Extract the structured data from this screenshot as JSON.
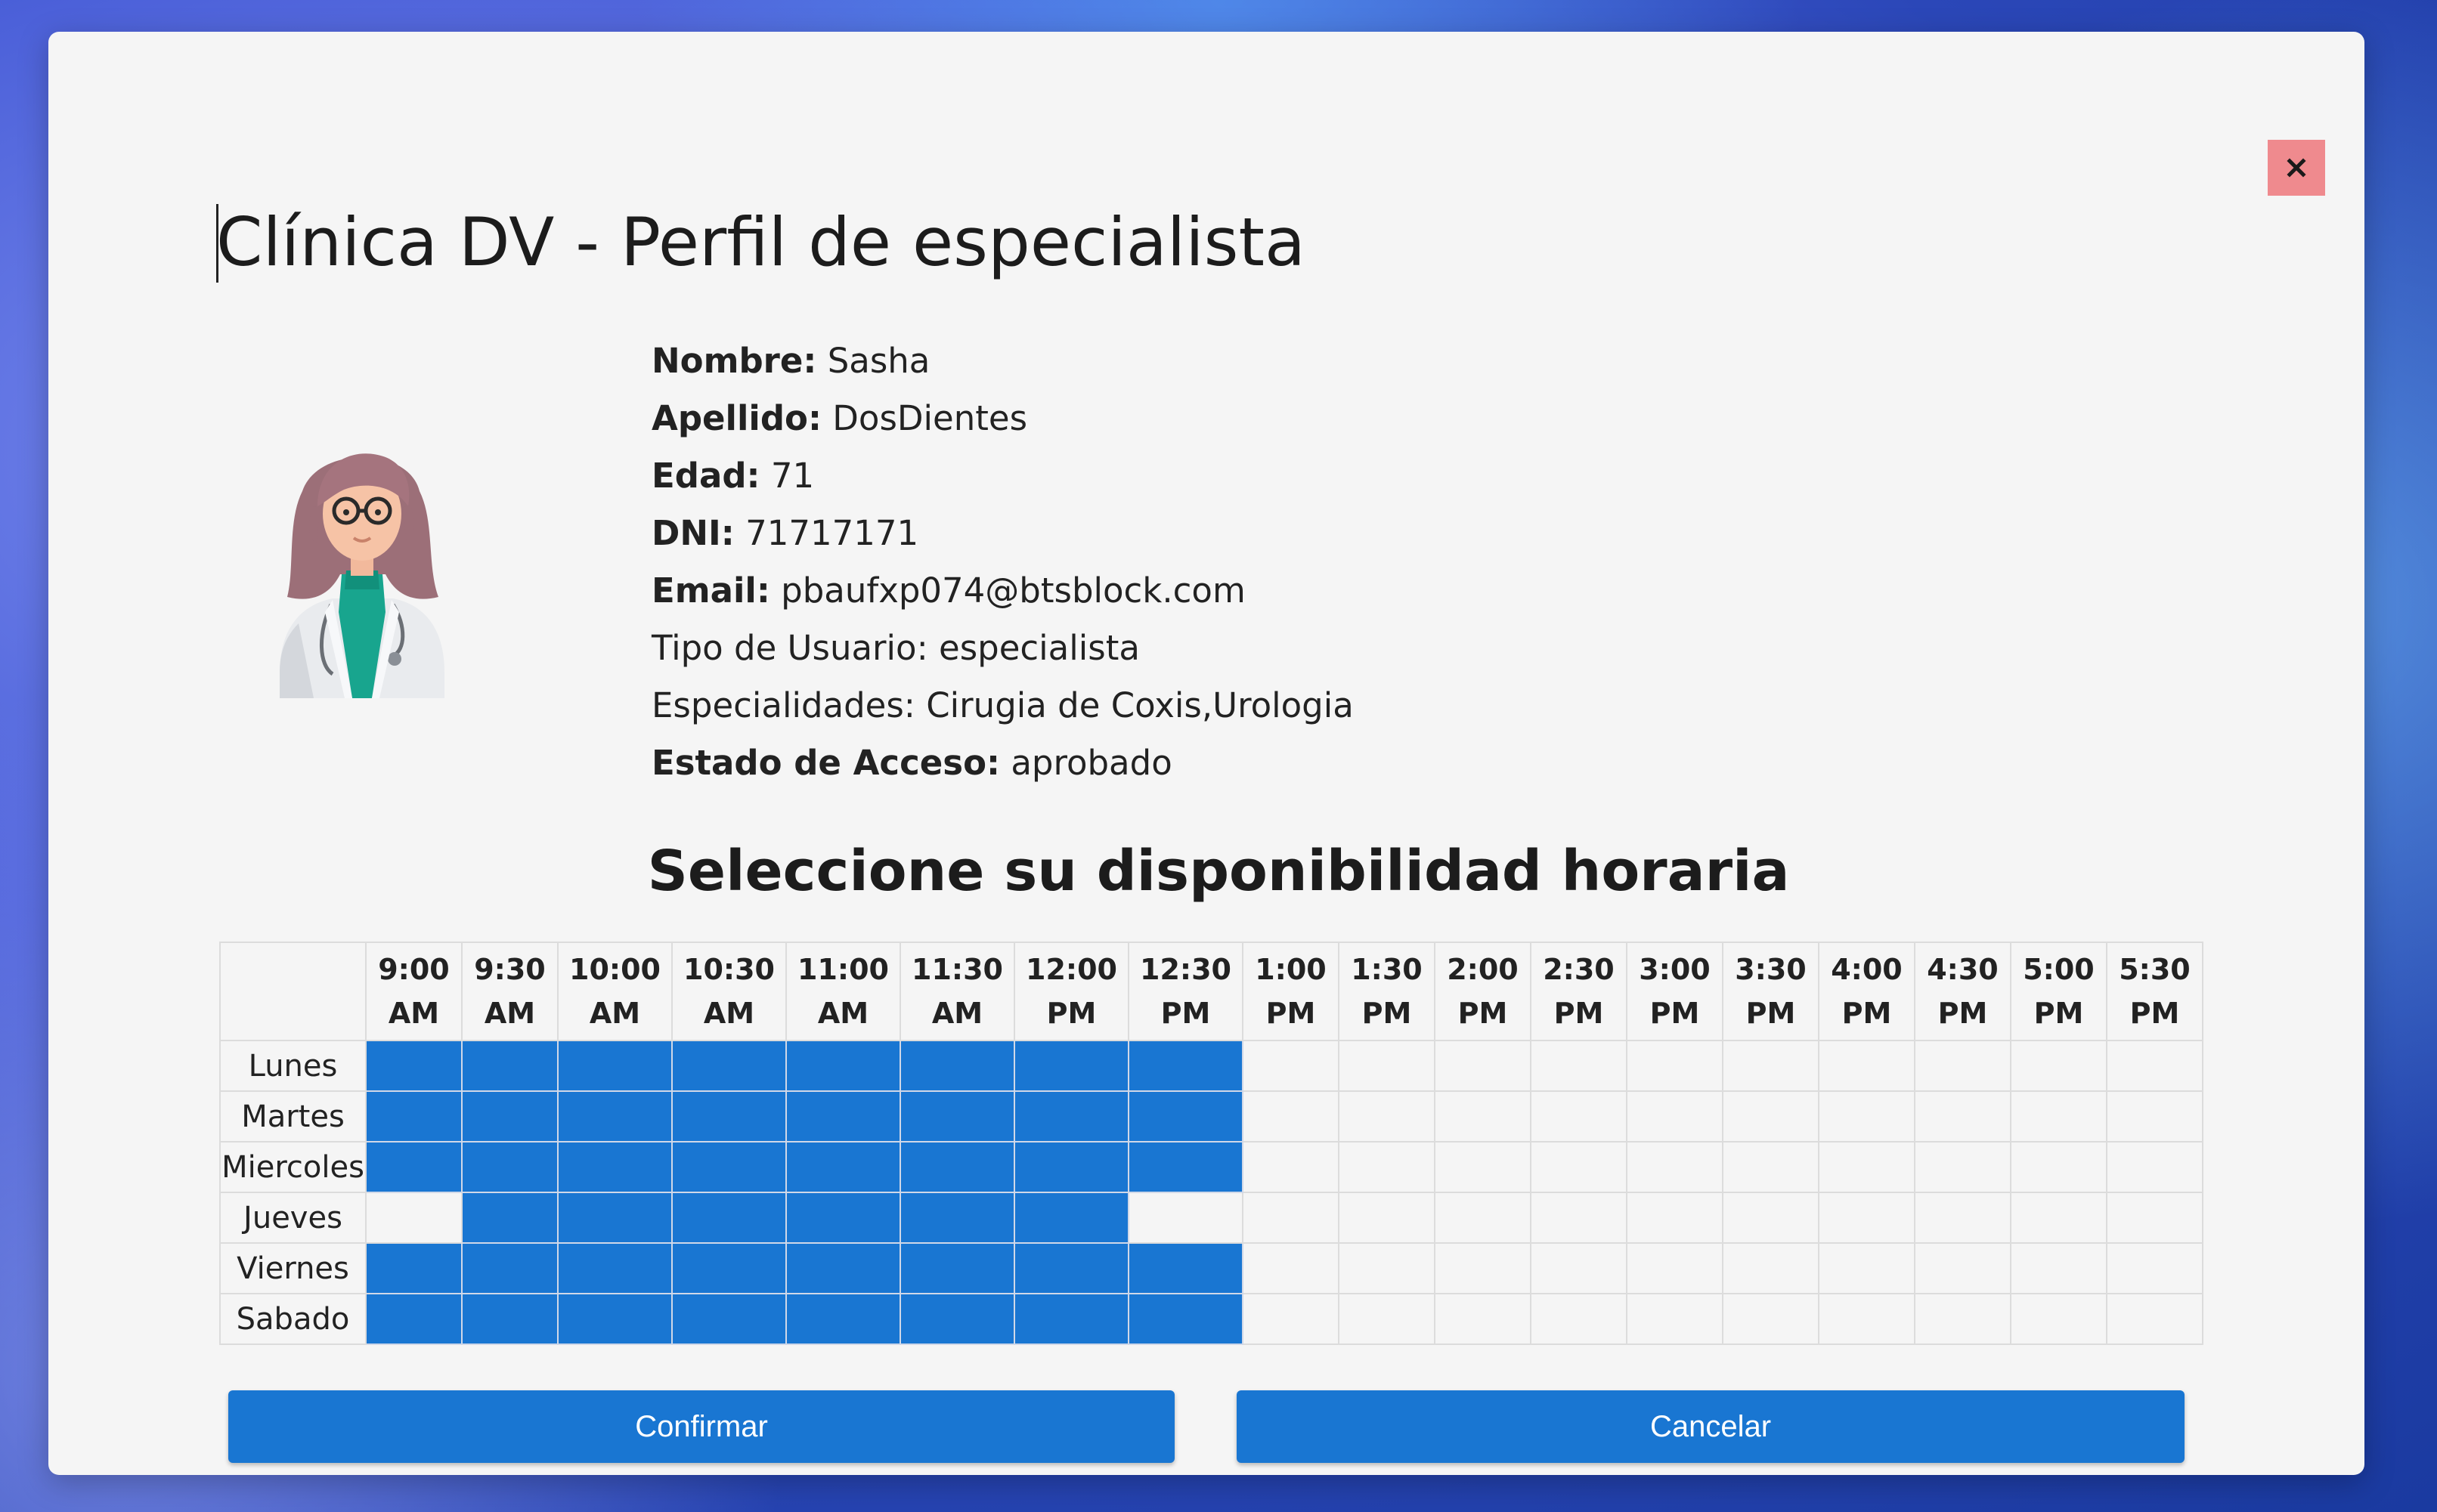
{
  "dialog": {
    "title": "Clínica DV - Perfil de especialista",
    "close_label": "×"
  },
  "profile": {
    "nombre_label": "Nombre:",
    "nombre": "Sasha",
    "apellido_label": "Apellido:",
    "apellido": "DosDientes",
    "edad_label": "Edad:",
    "edad": "71",
    "dni_label": "DNI:",
    "dni": "71717171",
    "email_label": "Email:",
    "email": "pbaufxp074@btsblock.com",
    "tipo": "Tipo de Usuario: especialista",
    "especialidades": "Especialidades: Cirugia de Coxis,Urologia",
    "estado_label": "Estado de Acceso:",
    "estado": "aprobado",
    "avatar_icon": "doctor-avatar-icon"
  },
  "schedule": {
    "title": "Seleccione su disponibilidad horaria",
    "times": [
      [
        "9:00",
        "AM"
      ],
      [
        "9:30",
        "AM"
      ],
      [
        "10:00",
        "AM"
      ],
      [
        "10:30",
        "AM"
      ],
      [
        "11:00",
        "AM"
      ],
      [
        "11:30",
        "AM"
      ],
      [
        "12:00",
        "PM"
      ],
      [
        "12:30",
        "PM"
      ],
      [
        "1:00",
        "PM"
      ],
      [
        "1:30",
        "PM"
      ],
      [
        "2:00",
        "PM"
      ],
      [
        "2:30",
        "PM"
      ],
      [
        "3:00",
        "PM"
      ],
      [
        "3:30",
        "PM"
      ],
      [
        "4:00",
        "PM"
      ],
      [
        "4:30",
        "PM"
      ],
      [
        "5:00",
        "PM"
      ],
      [
        "5:30",
        "PM"
      ]
    ],
    "days": [
      {
        "name": "Lunes",
        "selected": [
          1,
          1,
          1,
          1,
          1,
          1,
          1,
          1,
          0,
          0,
          0,
          0,
          0,
          0,
          0,
          0,
          0,
          0
        ]
      },
      {
        "name": "Martes",
        "selected": [
          1,
          1,
          1,
          1,
          1,
          1,
          1,
          1,
          0,
          0,
          0,
          0,
          0,
          0,
          0,
          0,
          0,
          0
        ]
      },
      {
        "name": "Miercoles",
        "selected": [
          1,
          1,
          1,
          1,
          1,
          1,
          1,
          1,
          0,
          0,
          0,
          0,
          0,
          0,
          0,
          0,
          0,
          0
        ]
      },
      {
        "name": "Jueves",
        "selected": [
          0,
          1,
          1,
          1,
          1,
          1,
          1,
          0,
          0,
          0,
          0,
          0,
          0,
          0,
          0,
          0,
          0,
          0
        ]
      },
      {
        "name": "Viernes",
        "selected": [
          1,
          1,
          1,
          1,
          1,
          1,
          1,
          1,
          0,
          0,
          0,
          0,
          0,
          0,
          0,
          0,
          0,
          0
        ]
      },
      {
        "name": "Sabado",
        "selected": [
          1,
          1,
          1,
          1,
          1,
          1,
          1,
          1,
          0,
          0,
          0,
          0,
          0,
          0,
          0,
          0,
          0,
          0
        ]
      }
    ],
    "selected_color": "#1976d2"
  },
  "actions": {
    "confirm_label": "Confirmar",
    "cancel_label": "Cancelar"
  }
}
